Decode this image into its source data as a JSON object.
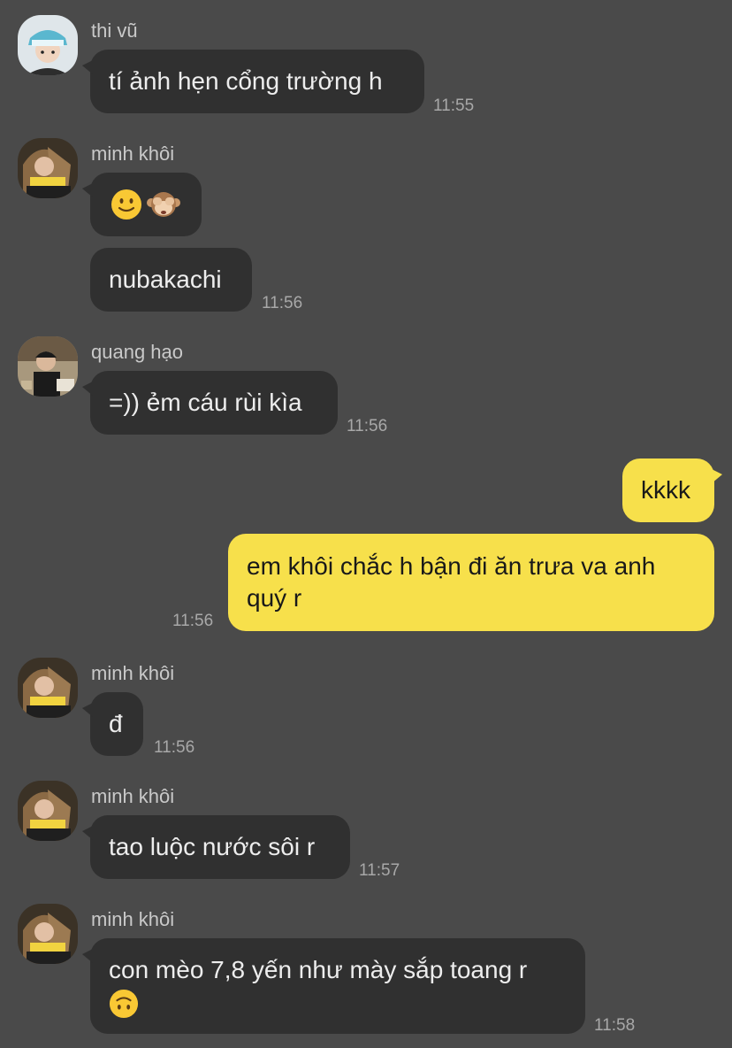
{
  "colors": {
    "background": "#4a4a4a",
    "incoming_bubble": "#303030",
    "outgoing_bubble": "#f7e04b",
    "incoming_text": "#ededed",
    "outgoing_text": "#191919",
    "timestamp": "#a8a8a8",
    "sender_name": "#c9c9c9"
  },
  "messages": [
    {
      "sender": "thi vũ",
      "avatar": "avatar-thi-vu",
      "text": "tí ảnh hẹn cổng trường h",
      "time": "11:55"
    },
    {
      "sender": "minh khôi",
      "avatar": "avatar-minh-khoi",
      "emojis": [
        "slightly-smiling-face-emoji",
        "see-no-evil-monkey-emoji"
      ]
    },
    {
      "text": "nubakachi",
      "time": "11:56"
    },
    {
      "sender": "quang hạo",
      "avatar": "avatar-quang-hao",
      "text": "=)) ẻm cáu rùi kìa",
      "time": "11:56"
    },
    {
      "outgoing": true,
      "text": "kkkk"
    },
    {
      "outgoing": true,
      "line1": "em khôi chắc h bận đi ăn trưa va anh",
      "line2": "quý r",
      "time": "11:56"
    },
    {
      "sender": "minh khôi",
      "avatar": "avatar-minh-khoi",
      "text": "đ",
      "time": "11:56"
    },
    {
      "sender": "minh khôi",
      "avatar": "avatar-minh-khoi",
      "text": "tao luộc nước sôi r",
      "time": "11:57"
    },
    {
      "sender": "minh khôi",
      "avatar": "avatar-minh-khoi",
      "line1": "con mèo 7,8 yến như mày sắp toang r",
      "emoji": "upside-down-face-emoji",
      "time": "11:58"
    }
  ]
}
